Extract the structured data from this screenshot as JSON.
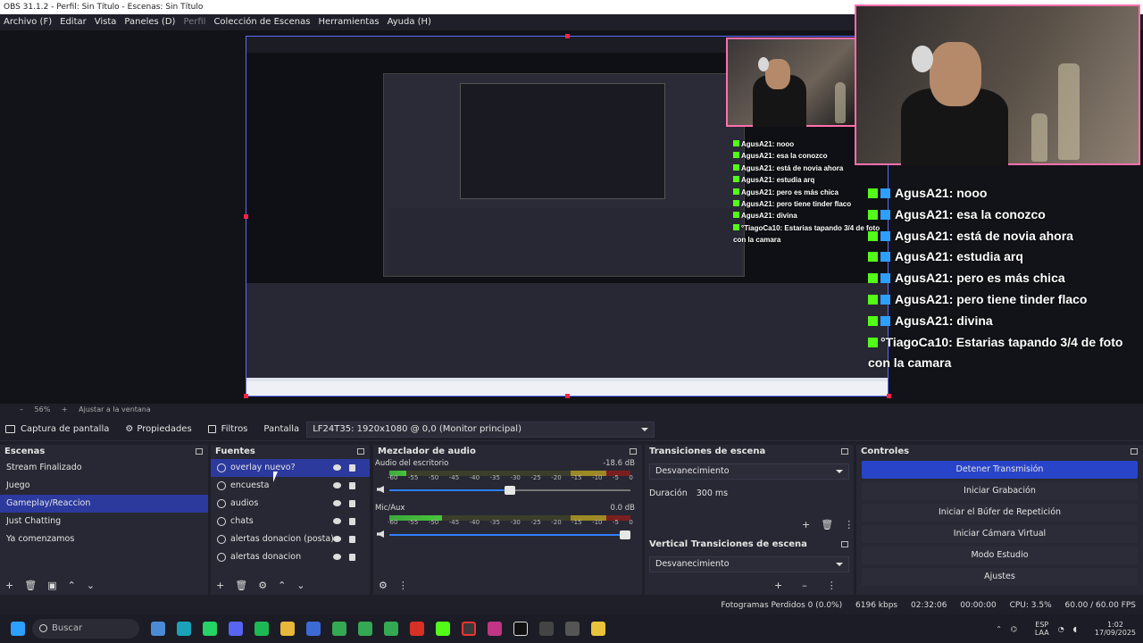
{
  "window": {
    "title": "OBS 31.1.2 - Perfil: Sin Título - Escenas: Sin Título"
  },
  "menubar": {
    "items": [
      "Archivo (F)",
      "Editar",
      "Vista",
      "Paneles (D)",
      "Perfil",
      "Colección de Escenas",
      "Herramientas",
      "Ayuda (H)"
    ]
  },
  "chat": {
    "lines": [
      {
        "user": "AgusA21",
        "msg": ": nooo"
      },
      {
        "user": "AgusA21",
        "msg": ": esa la conozco"
      },
      {
        "user": "AgusA21",
        "msg": ": está de novia ahora"
      },
      {
        "user": "AgusA21",
        "msg": ": estudia arq"
      },
      {
        "user": "AgusA21",
        "msg": ": pero es más chica"
      },
      {
        "user": "AgusA21",
        "msg": ": pero tiene tinder flaco"
      },
      {
        "user": "AgusA21",
        "msg": ": divina"
      }
    ],
    "last_user": "°TiagoCa10",
    "last_msg": ": Estarias tapando 3/4 de foto",
    "last_msg2": "con la camara"
  },
  "zoom": {
    "percent": "56%",
    "fit_label": "Ajustar a la ventana"
  },
  "source_toolbar": {
    "source_name": "Captura de pantalla",
    "properties": "Propiedades",
    "filters": "Filtros",
    "screen_label": "Pantalla",
    "screen_value": "LF24T35: 1920x1080 @ 0,0 (Monitor principal)"
  },
  "docks": {
    "scenes_title": "Escenas",
    "sources_title": "Fuentes",
    "mixer_title": "Mezclador de audio",
    "transitions_title": "Transiciones de escena",
    "vertical_transitions_title": "Vertical Transiciones de escena",
    "controls_title": "Controles"
  },
  "scenes": [
    "Stream Finalizado",
    "Juego",
    "Gameplay/Reaccion",
    "Just Chatting",
    "Ya comenzamos"
  ],
  "sources": [
    "overlay nuevo?",
    "encuesta",
    "audios",
    "chats",
    "alertas donacion (posta)",
    "alertas donacion"
  ],
  "mixer": {
    "ch1_name": "Audio del escritorio",
    "ch1_db": "-18.6 dB",
    "ch1_level": 0.07,
    "ch1_volume": 0.5,
    "ch2_name": "Mic/Aux",
    "ch2_db": "0.0 dB",
    "ch2_level": 0.22,
    "ch2_volume": 1.0,
    "ticks": [
      "-60",
      "-55",
      "-50",
      "-45",
      "-40",
      "-35",
      "-30",
      "-25",
      "-20",
      "-15",
      "-10",
      "-5",
      "0"
    ]
  },
  "transitions": {
    "selected": "Desvanecimiento",
    "duration_label": "Duración",
    "duration_value": "300 ms"
  },
  "vertical_transitions": {
    "selected": "Desvanecimiento"
  },
  "controls": [
    "Detener Transmisión",
    "Iniciar Grabación",
    "Iniciar el Búfer de Repetición",
    "Iniciar Cámara Virtual",
    "Modo Estudio",
    "Ajustes"
  ],
  "status": {
    "dropped": "Fotogramas Perdidos 0 (0.0%)",
    "bitrate": "6196 kbps",
    "live_time": "02:32:06",
    "rec_time": "00:00:00",
    "cpu": "CPU: 3.5%",
    "fps": "60.00 / 60.00 FPS"
  },
  "taskbar": {
    "search_placeholder": "Buscar",
    "lang": "ESP",
    "lang2": "LAA",
    "time": "1:02",
    "date": "17/09/2025"
  }
}
